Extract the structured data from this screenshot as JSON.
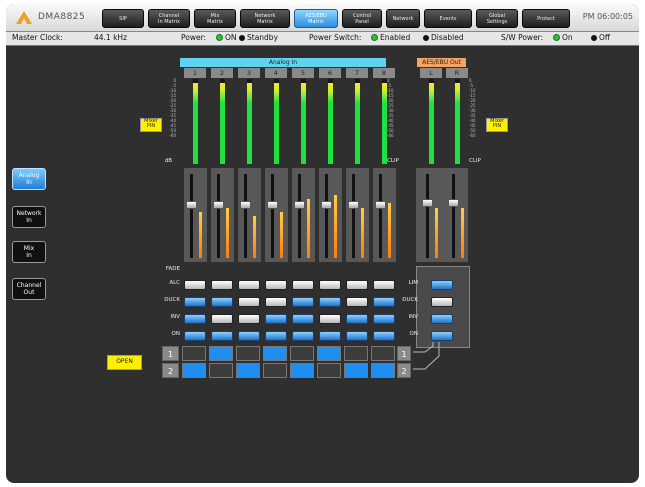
{
  "brand": "DMA8825",
  "clock": "PM 06:00:05",
  "tabs": [
    {
      "label": "SIP",
      "active": false
    },
    {
      "label": "Channel\nIn Matrix",
      "active": false
    },
    {
      "label": "Mix\nMatrix",
      "active": false
    },
    {
      "label": "Network\nMatrix",
      "active": false
    },
    {
      "label": "AES/EBU\nMatrix",
      "active": true
    },
    {
      "label": "Control\nPanel",
      "active": false
    },
    {
      "label": "Network",
      "active": false
    },
    {
      "label": "Events",
      "active": false
    },
    {
      "label": "Global\nSettings",
      "active": false
    },
    {
      "label": "Protect",
      "active": false
    }
  ],
  "status": {
    "master_clock_label": "Master Clock:",
    "master_clock_value": "44.1 kHz",
    "power_label": "Power:",
    "power_on": "ON",
    "power_standby": "Standby",
    "power_switch_label": "Power Switch:",
    "ps_enabled": "Enabled",
    "ps_disabled": "Disabled",
    "sw_power_label": "S/W Power:",
    "sw_on": "On",
    "sw_off": "Off"
  },
  "side_nav": [
    {
      "label": "Analog\nIn",
      "active": true
    },
    {
      "label": "Network\nIn",
      "active": false
    },
    {
      "label": "Mix\nIn",
      "active": false
    },
    {
      "label": "Channel\nOut",
      "active": false
    }
  ],
  "analog_in": {
    "header": "Analog In",
    "channels": [
      "1",
      "2",
      "3",
      "4",
      "5",
      "6",
      "7",
      "8"
    ],
    "meter_levels": [
      0.95,
      0.95,
      0.95,
      0.95,
      0.95,
      0.95,
      0.95,
      0.95
    ],
    "gain_levels": [
      0.55,
      0.6,
      0.5,
      0.55,
      0.7,
      0.75,
      0.6,
      0.65
    ],
    "fader_positions": [
      0.32,
      0.32,
      0.32,
      0.32,
      0.32,
      0.32,
      0.32,
      0.32
    ],
    "alc": [
      false,
      false,
      false,
      false,
      false,
      false,
      false,
      false
    ],
    "duck": [
      true,
      true,
      false,
      false,
      true,
      true,
      false,
      true
    ],
    "inv": [
      true,
      false,
      false,
      true,
      true,
      false,
      true,
      true
    ],
    "on": [
      true,
      true,
      true,
      true,
      true,
      true,
      true,
      true
    ]
  },
  "aes_out": {
    "header": "AES/EBU Out",
    "channels": [
      "L",
      "R"
    ],
    "meter_levels": [
      0.95,
      0.95
    ],
    "gain_levels": [
      0.6,
      0.6
    ],
    "fader_positions": [
      0.3,
      0.3
    ],
    "lim": true,
    "duck": false,
    "inv": true,
    "on": true
  },
  "row_labels": {
    "fade": "FADE",
    "alc": "ALC",
    "duck": "DUCK",
    "inv": "INV",
    "on": "ON",
    "lim": "LIM"
  },
  "db_label": "dB",
  "clip_label": "CLIP",
  "scale_labels": "0\n-5\n-10\n-15\n-20\n-25\n-30\n-35\n-40\n-45\n-50\n-60",
  "matrix": {
    "rows": [
      "1",
      "2"
    ],
    "outs": [
      "1",
      "2"
    ],
    "cells": [
      [
        false,
        true,
        false,
        true,
        false,
        true,
        false,
        false
      ],
      [
        true,
        false,
        true,
        false,
        true,
        false,
        true,
        true
      ]
    ]
  },
  "yellow_labels": {
    "left_top": "Mixer\nPIN",
    "right_top": "Mixer\nPIN",
    "left_bottom": "OPEN"
  },
  "colors": {
    "active_tab": "#2b8de0",
    "meter_green": "#1fe040",
    "button_on": "#1e74c8",
    "matrix_on": "#1e8ff0",
    "header_cyan": "#5fd3f0",
    "header_orange": "#f4a460"
  }
}
